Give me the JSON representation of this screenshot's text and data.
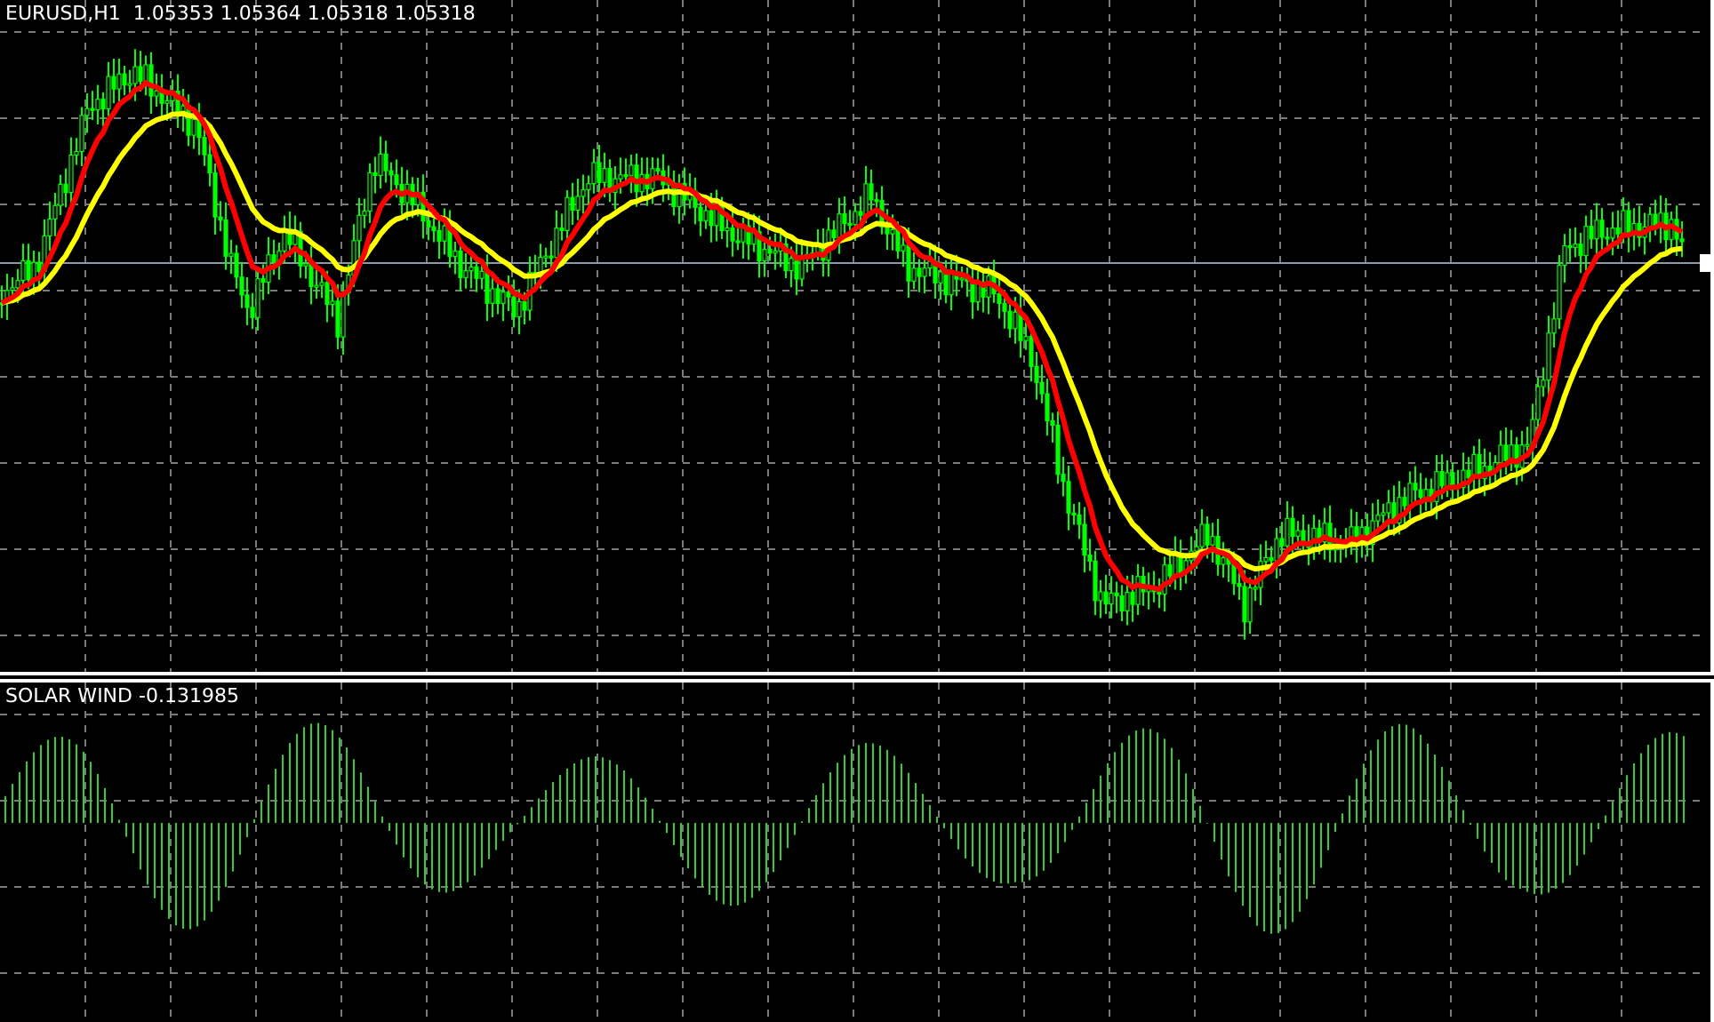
{
  "main_chart": {
    "title": "EURUSD,H1  1.05353 1.05364 1.05318 1.05318"
  },
  "indicator": {
    "title": "SOLAR WIND -0.131985"
  }
}
